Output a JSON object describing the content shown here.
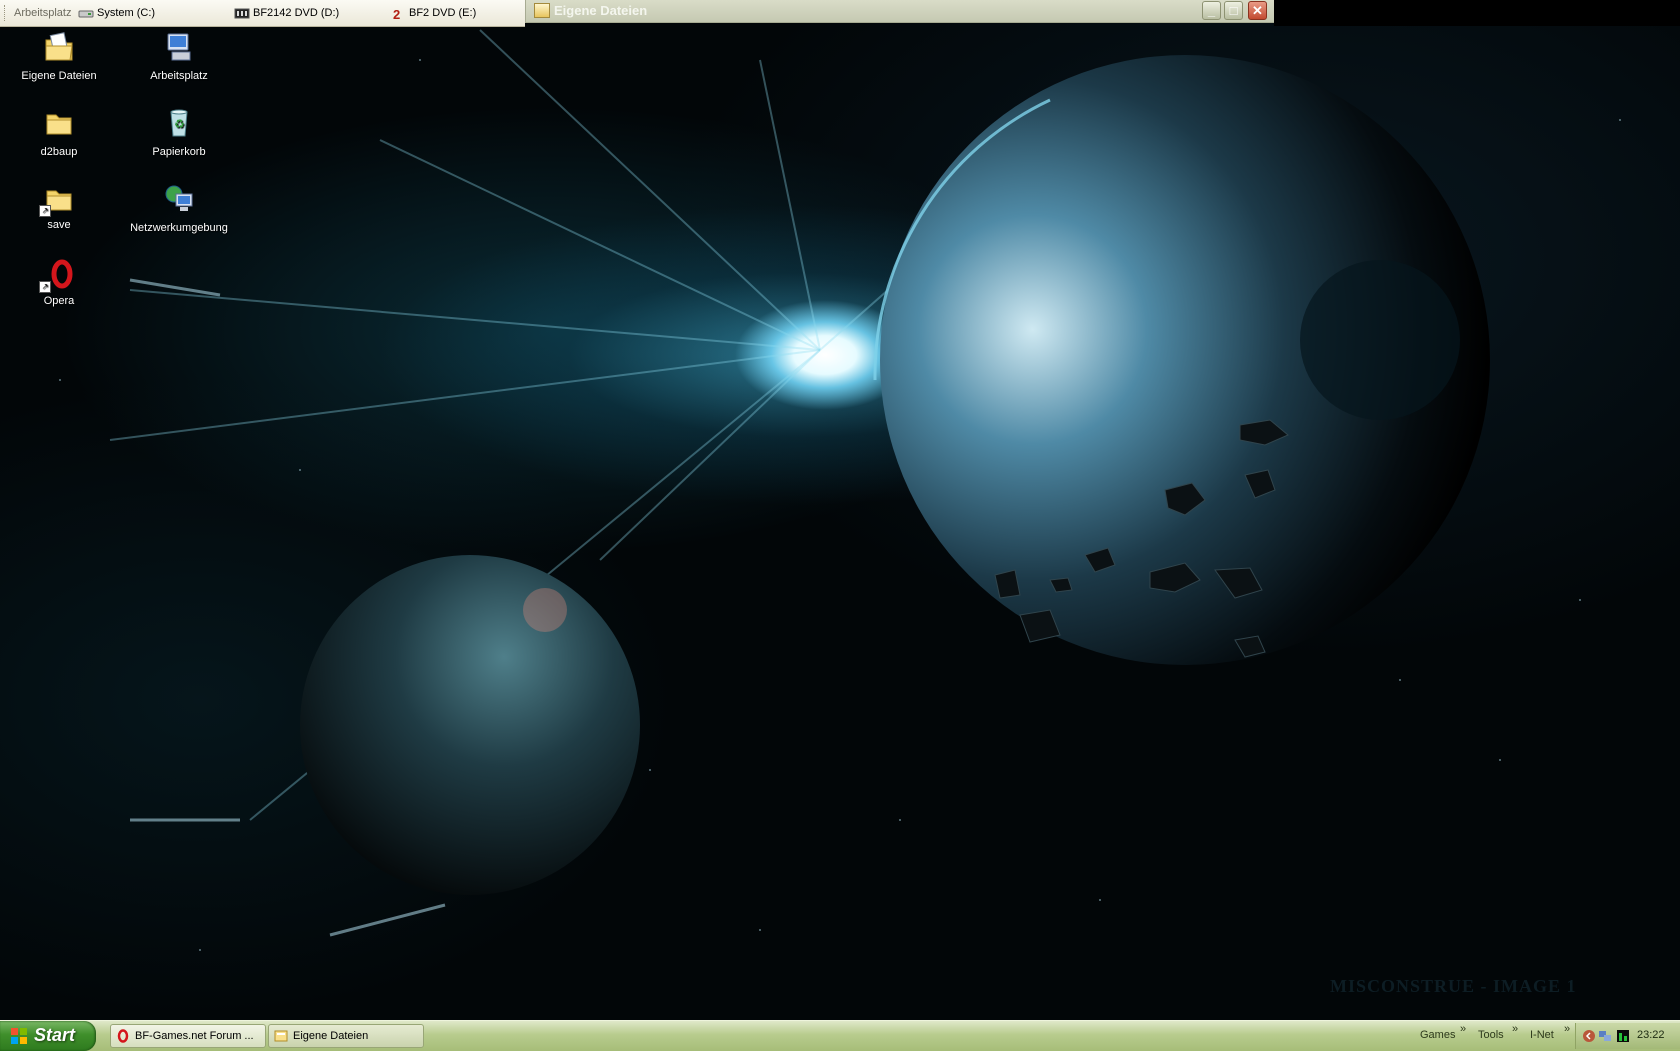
{
  "topbar": {
    "title": "Arbeitsplatz",
    "drives": [
      {
        "label": "System (C:)",
        "icon": "hard-drive-icon"
      },
      {
        "label": "BF2142 DVD (D:)",
        "icon": "dvd-drive-icon"
      },
      {
        "label": "BF2 DVD (E:)",
        "icon": "bf2-disc-icon"
      }
    ]
  },
  "explorer_window": {
    "title": "Eigene Dateien",
    "buttons": [
      "minimize",
      "maximize",
      "close"
    ]
  },
  "desktop_icons": [
    {
      "label": "Eigene Dateien",
      "icon": "my-documents-icon"
    },
    {
      "label": "Arbeitsplatz",
      "icon": "my-computer-icon"
    },
    {
      "label": "d2baup",
      "icon": "folder-icon"
    },
    {
      "label": "Papierkorb",
      "icon": "recycle-bin-icon"
    },
    {
      "label": "save",
      "icon": "folder-shortcut-icon"
    },
    {
      "label": "Netzwerkumgebung",
      "icon": "network-icon"
    },
    {
      "label": "Opera",
      "icon": "opera-shortcut-icon"
    }
  ],
  "wallpaper": {
    "caption": "MISCONSTRUE - IMAGE 1"
  },
  "taskbar": {
    "start_label": "Start",
    "tasks": [
      {
        "label": "BF-Games.net Forum ...",
        "icon": "opera-icon"
      },
      {
        "label": "Eigene Dateien",
        "icon": "folder-window-icon"
      }
    ],
    "quick_launch": [
      "Games",
      "Tools",
      "I-Net"
    ],
    "clock": "23:22",
    "colors": {
      "start_green": "#3f8f2b",
      "taskbar_olive": "#b8cc8e"
    }
  }
}
